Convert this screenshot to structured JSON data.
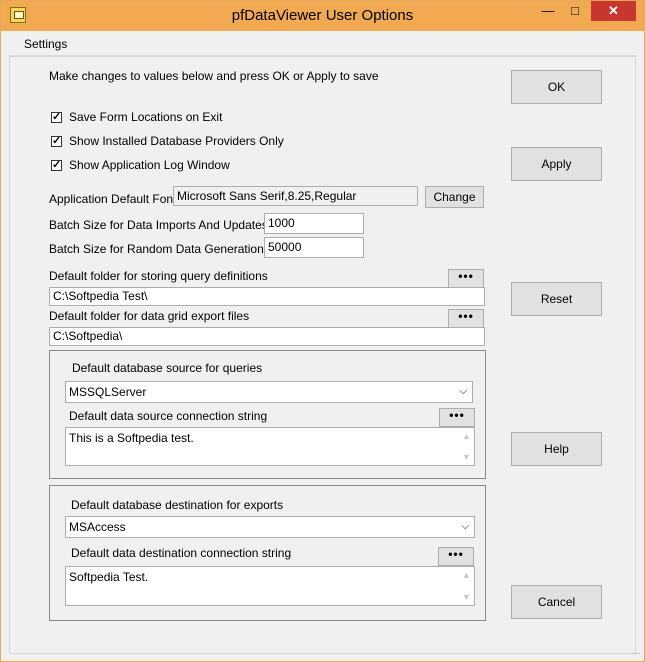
{
  "window": {
    "title": "pfDataViewer User Options"
  },
  "menu": {
    "settings": "Settings"
  },
  "intro": "Make changes to values below and press OK or Apply to save",
  "checkboxes": [
    {
      "label": "Save Form Locations on Exit",
      "checked": true
    },
    {
      "label": "Show Installed Database Providers Only",
      "checked": true
    },
    {
      "label": "Show Application Log Window",
      "checked": true
    }
  ],
  "font": {
    "label": "Application Default Font",
    "value": "Microsoft Sans Serif,8.25,Regular",
    "change_button": "Change"
  },
  "batch_import": {
    "label": "Batch Size for Data Imports And Updates",
    "value": "1000"
  },
  "batch_random": {
    "label": "Batch Size for Random Data Generation",
    "value": "50000"
  },
  "query_folder": {
    "label": "Default folder for storing query definitions",
    "value": "C:\\Softpedia Test\\",
    "browse": "•••"
  },
  "export_folder": {
    "label": "Default folder for data grid export files",
    "value": "C:\\Softpedia\\",
    "browse": "•••"
  },
  "source": {
    "label": "Default database source for queries",
    "selected": "MSSQLServer",
    "conn_label": "Default data source connection string",
    "conn_value": "This is a Softpedia test.",
    "browse": "•••"
  },
  "destination": {
    "label": "Default database destination for exports",
    "selected": "MSAccess",
    "conn_label": "Default data destination connection string",
    "conn_value": "Softpedia Test.",
    "browse": "•••"
  },
  "buttons": {
    "ok": "OK",
    "apply": "Apply",
    "reset": "Reset",
    "help": "Help",
    "cancel": "Cancel"
  },
  "colors": {
    "titlebar": "#f2aa52",
    "close": "#c7372f",
    "dialog_bg": "#f0f0f0"
  }
}
